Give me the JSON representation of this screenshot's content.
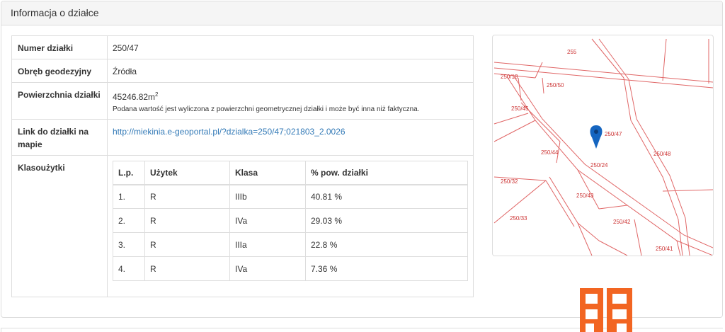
{
  "panel": {
    "title": "Informacja o działce"
  },
  "parcel": {
    "number_label": "Numer działki",
    "number_value": "250/47",
    "precinct_label": "Obręb geodezyjny",
    "precinct_value": "Źródła",
    "area_label": "Powierzchnia działki",
    "area_value": "45246.82m",
    "area_sup": "2",
    "area_note": "Podana wartość jest wyliczona z powierzchni geometrycznej działki i może być inna niż faktyczna.",
    "link_label": "Link do działki na mapie",
    "link_value": "http://miekinia.e-geoportal.pl/?dzialka=250/47;021803_2.0026",
    "land_use_label": "Klasoużytki"
  },
  "land_use_table": {
    "headers": [
      "L.p.",
      "Użytek",
      "Klasa",
      "% pow. działki"
    ],
    "rows": [
      [
        "1.",
        "R",
        "IIIb",
        "40.81 %"
      ],
      [
        "2.",
        "R",
        "IVa",
        "29.03 %"
      ],
      [
        "3.",
        "R",
        "IIIa",
        "22.8 %"
      ],
      [
        "4.",
        "R",
        "IVa",
        "7.36 %"
      ]
    ]
  },
  "map": {
    "labels": [
      "255",
      "250/18",
      "250/50",
      "250/45",
      "250/47",
      "250/44",
      "250/48",
      "250/24",
      "250/32",
      "250/43",
      "250/33",
      "250/42",
      "250/41"
    ],
    "line_color": "#e06666",
    "label_color": "#cc3333",
    "marker_color": "#1565c0"
  },
  "logo": {
    "color": "#f26522"
  }
}
